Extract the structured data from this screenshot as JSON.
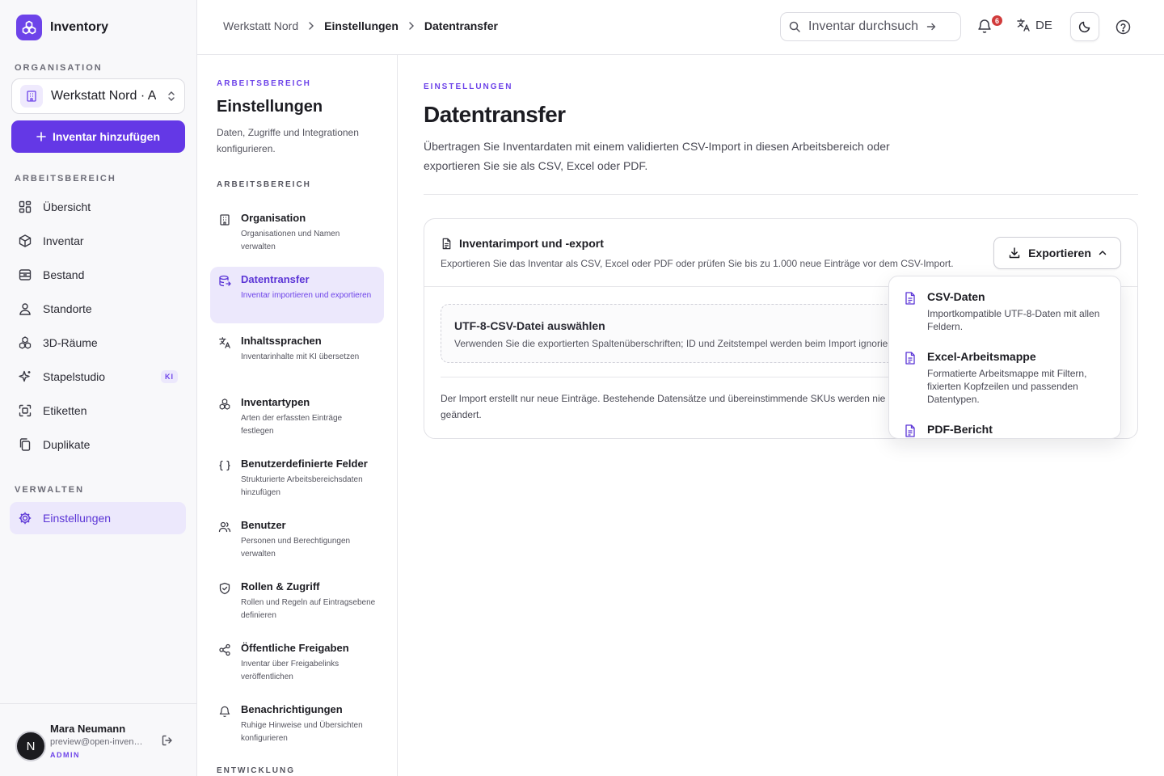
{
  "app": {
    "name": "Inventory"
  },
  "sidebar": {
    "org_label": "ORGANISATION",
    "org_name": "Werkstatt Nord · Admin",
    "add_button": "Inventar hinzufügen",
    "workspace_label": "ARBEITSBEREICH",
    "items": [
      {
        "label": "Übersicht",
        "icon": "grid-icon"
      },
      {
        "label": "Inventar",
        "icon": "box-icon"
      },
      {
        "label": "Bestand",
        "icon": "archive-icon"
      },
      {
        "label": "Standorte",
        "icon": "location-icon"
      },
      {
        "label": "3D-Räume",
        "icon": "cubes-icon"
      },
      {
        "label": "Stapelstudio",
        "icon": "sparkle-icon",
        "badge": "KI"
      },
      {
        "label": "Etiketten",
        "icon": "scan-icon"
      },
      {
        "label": "Duplikate",
        "icon": "copy-icon"
      }
    ],
    "manage_label": "VERWALTEN",
    "manage_items": [
      {
        "label": "Einstellungen",
        "icon": "gear-icon",
        "active": true
      }
    ],
    "user": {
      "initial": "N",
      "name": "Mara Neumann",
      "email": "preview@open-inventory.app",
      "role": "ADMIN"
    }
  },
  "topbar": {
    "breadcrumbs": [
      "Werkstatt Nord",
      "Einstellungen",
      "Datentransfer"
    ],
    "search_placeholder": "Inventar durchsuchen",
    "notification_count": "6",
    "language": "DE"
  },
  "settings_nav": {
    "eyebrow": "ARBEITSBEREICH",
    "title": "Einstellungen",
    "description": "Daten, Zugriffe und Integrationen konfigurieren.",
    "section_label": "ARBEITSBEREICH",
    "items": [
      {
        "title": "Organisation",
        "desc": "Organisationen und Namen verwalten",
        "icon": "building-icon"
      },
      {
        "title": "Datentransfer",
        "desc": "Inventar importieren und exportieren",
        "icon": "database-transfer-icon",
        "active": true
      },
      {
        "title": "Inhaltssprachen",
        "desc": "Inventarinhalte mit KI übersetzen",
        "icon": "translate-icon"
      },
      {
        "title": "Inventartypen",
        "desc": "Arten der erfassten Einträge festlegen",
        "icon": "cubes-icon"
      },
      {
        "title": "Benutzerdefinierte Felder",
        "desc": "Strukturierte Arbeitsbereichsdaten hinzufügen",
        "icon": "braces-icon"
      },
      {
        "title": "Benutzer",
        "desc": "Personen und Berechtigungen verwalten",
        "icon": "users-icon"
      },
      {
        "title": "Rollen & Zugriff",
        "desc": "Rollen und Regeln auf Eintragsebene definieren",
        "icon": "shield-icon"
      },
      {
        "title": "Öffentliche Freigaben",
        "desc": "Inventar über Freigabelinks veröffentlichen",
        "icon": "share-icon"
      },
      {
        "title": "Benachrichtigungen",
        "desc": "Ruhige Hinweise und Übersichten konfigurieren",
        "icon": "bell-icon"
      }
    ],
    "dev_label": "ENTWICKLUNG"
  },
  "main": {
    "eyebrow": "EINSTELLUNGEN",
    "title": "Datentransfer",
    "description": "Übertragen Sie Inventardaten mit einem validierten CSV-Import in diesen Arbeitsbereich oder exportieren Sie sie als CSV, Excel oder PDF.",
    "card": {
      "title": "Inventarimport und -export",
      "subtitle": "Exportieren Sie das Inventar als CSV, Excel oder PDF oder prüfen Sie bis zu 1.000 neue Einträge vor dem CSV-Import.",
      "export_button": "Exportieren",
      "dropzone_title": "UTF-8-CSV-Datei auswählen",
      "dropzone_sub": "Verwenden Sie die exportierten Spaltenüberschriften; ID und Zeitstempel werden beim Import ignoriert.",
      "note": "Der Import erstellt nur neue Einträge. Bestehende Datensätze und übereinstimmende SKUs werden nie geändert."
    },
    "export_menu": [
      {
        "title": "CSV-Daten",
        "desc": "Importkompatible UTF-8-Daten mit allen Feldern."
      },
      {
        "title": "Excel-Arbeitsmappe",
        "desc": "Formatierte Arbeitsmappe mit Filtern, fixierten Kopfzeilen und passenden Datentypen."
      },
      {
        "title": "PDF-Bericht",
        "desc": ""
      }
    ]
  },
  "colors": {
    "accent": "#6438e6",
    "accent_soft": "#ece8fc",
    "badge_red": "#d13b3b"
  }
}
